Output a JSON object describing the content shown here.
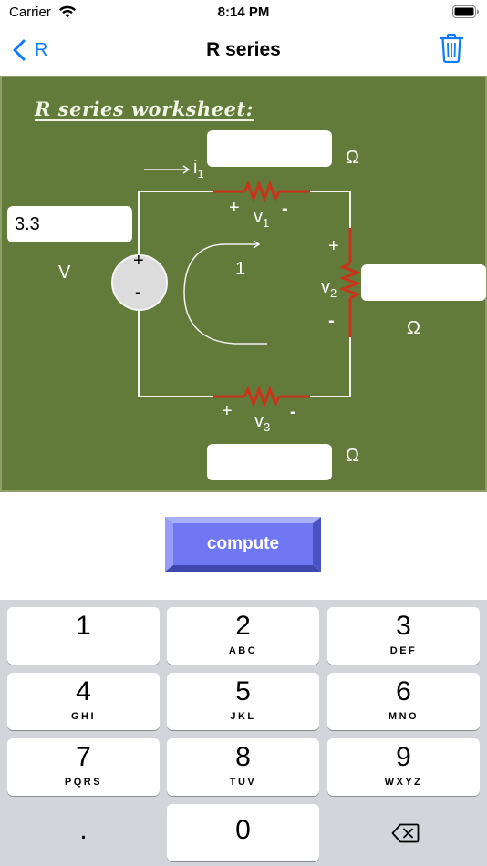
{
  "status_bar": {
    "carrier": "Carrier",
    "time": "8:14 PM"
  },
  "nav": {
    "back_label": "R",
    "title": "R series"
  },
  "worksheet": {
    "title": "R series worksheet:",
    "voltage_value": "3.3",
    "voltage_unit": "V",
    "r1_value": "",
    "r2_value": "",
    "r3_value": "",
    "ohm": "Ω",
    "current_label": "i",
    "current_sub": "1",
    "loop_label": "1",
    "v1": {
      "plus": "+",
      "name": "v",
      "sub": "1",
      "minus": "-"
    },
    "v2": {
      "plus": "+",
      "name": "v",
      "sub": "2",
      "minus": "-"
    },
    "v3": {
      "plus": "+",
      "name": "v",
      "sub": "3",
      "minus": "-"
    },
    "source": {
      "plus": "+",
      "minus": "-"
    }
  },
  "compute_label": "compute",
  "keyboard": {
    "keys": [
      {
        "digit": "1",
        "letters": ""
      },
      {
        "digit": "2",
        "letters": "ABC"
      },
      {
        "digit": "3",
        "letters": "DEF"
      },
      {
        "digit": "4",
        "letters": "GHI"
      },
      {
        "digit": "5",
        "letters": "JKL"
      },
      {
        "digit": "6",
        "letters": "MNO"
      },
      {
        "digit": "7",
        "letters": "PQRS"
      },
      {
        "digit": "8",
        "letters": "TUV"
      },
      {
        "digit": "9",
        "letters": "WXYZ"
      }
    ],
    "decimal": ".",
    "zero": "0"
  },
  "colors": {
    "board": "#627a3a",
    "resistor": "#c8341b",
    "accent": "#0a7aff",
    "compute": "#6f78f2"
  },
  "icons": [
    "wifi-icon",
    "battery-icon",
    "chevron-left-icon",
    "trash-icon",
    "delete-backspace-icon"
  ]
}
